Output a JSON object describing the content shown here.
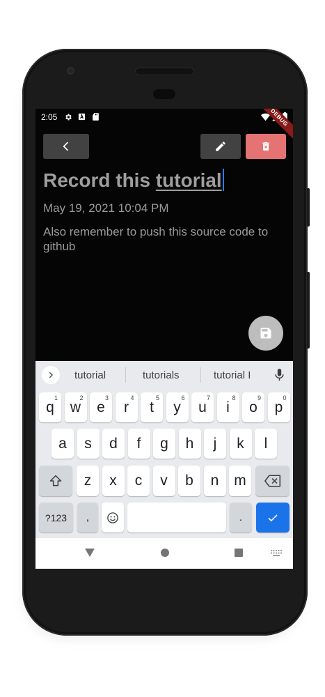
{
  "status_bar": {
    "time": "2:05",
    "debug_banner": "DEBUG"
  },
  "note": {
    "title_prefix": "Record this ",
    "title_underlined": "tutorial",
    "date": "May 19, 2021 10:04 PM",
    "body": "Also remember to push this source code to github"
  },
  "keyboard": {
    "suggestions": [
      "tutorial",
      "tutorials",
      "tutorial I"
    ],
    "row1": [
      {
        "key": "q",
        "hint": "1"
      },
      {
        "key": "w",
        "hint": "2"
      },
      {
        "key": "e",
        "hint": "3"
      },
      {
        "key": "r",
        "hint": "4"
      },
      {
        "key": "t",
        "hint": "5"
      },
      {
        "key": "y",
        "hint": "6"
      },
      {
        "key": "u",
        "hint": "7"
      },
      {
        "key": "i",
        "hint": "8"
      },
      {
        "key": "o",
        "hint": "9"
      },
      {
        "key": "p",
        "hint": "0"
      }
    ],
    "row2": [
      "a",
      "s",
      "d",
      "f",
      "g",
      "h",
      "j",
      "k",
      "l"
    ],
    "row3": [
      "z",
      "x",
      "c",
      "v",
      "b",
      "n",
      "m"
    ],
    "symbols_label": "?123",
    "comma_label": ",",
    "period_label": "."
  },
  "colors": {
    "accent_blue": "#1a73e8",
    "delete_red": "#e57373",
    "button_gray": "#424242",
    "fab_gray": "#bdbdbd"
  }
}
